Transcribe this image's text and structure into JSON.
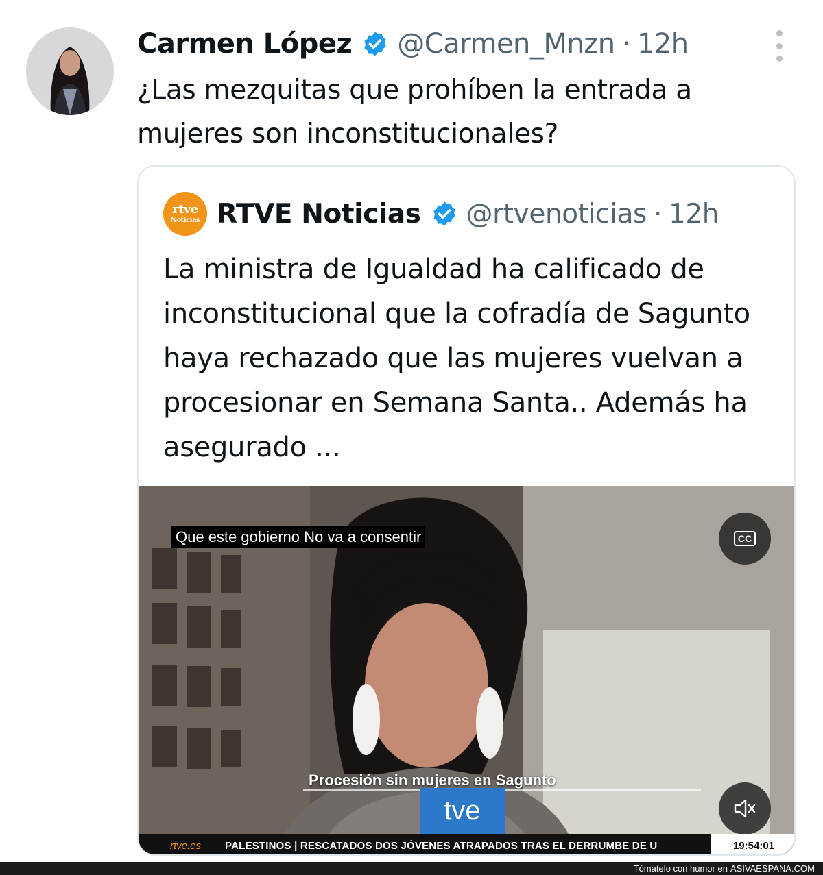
{
  "tweet": {
    "author_name": "Carmen López",
    "handle": "@Carmen_Mnzn",
    "separator": "·",
    "time": "12h",
    "text": "¿Las mezquitas que prohíben la entrada a mujeres son inconstitucionales?",
    "verified_icon": "verified-badge-icon",
    "menu_icon": "more-vertical-icon"
  },
  "quoted": {
    "logo_line1": "rtve",
    "logo_line2": "Noticias",
    "author_name": "RTVE Noticias",
    "handle": "@rtvenoticias",
    "separator": "·",
    "time": "12h",
    "text": "La ministra de Igualdad ha calificado de inconstitucional que la cofradía de Sagunto haya rechazado que las mujeres vuelvan a procesionar en Semana Santa.. Además ha asegurado ..."
  },
  "video": {
    "subtitle": "Que este gobierno No va a consentir",
    "cc_label": "CC",
    "lower_third": "Procesión sin mujeres en Sagunto",
    "mic_label": "tve",
    "ticker_brand": "rtve.es",
    "ticker_text": "PALESTINOS  |  RESCATADOS DOS JÓVENES ATRAPADOS TRAS EL DERRUMBE DE U",
    "clock": "19:54:01",
    "mute_icon": "volume-muted-icon"
  },
  "footer": {
    "tagline": "Tómatelo con humor en",
    "site": "ASIVAESPANA.COM"
  },
  "colors": {
    "verified_blue": "#1d9bf0",
    "rtve_orange": "#f29418",
    "secondary_text": "#536471"
  }
}
